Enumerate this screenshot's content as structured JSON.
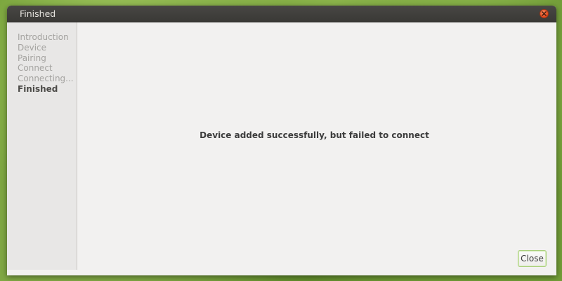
{
  "window": {
    "title": "Finished"
  },
  "sidebar": {
    "steps": [
      {
        "label": "Introduction",
        "current": false
      },
      {
        "label": "Device",
        "current": false
      },
      {
        "label": "Pairing",
        "current": false
      },
      {
        "label": "Connect",
        "current": false
      },
      {
        "label": "Connecting...",
        "current": false
      },
      {
        "label": "Finished",
        "current": true
      }
    ]
  },
  "main": {
    "message": "Device added successfully, but failed to connect"
  },
  "actions": {
    "close_label": "Close"
  },
  "colors": {
    "titlebar": "#3f3e3b",
    "close_button_accent": "#e2481c",
    "button_focus_border": "#a9cf7a",
    "sidebar_bg": "#e8e7e6",
    "window_bg": "#f2f1f0"
  },
  "icons": {
    "titlebar_close": "close-icon"
  }
}
